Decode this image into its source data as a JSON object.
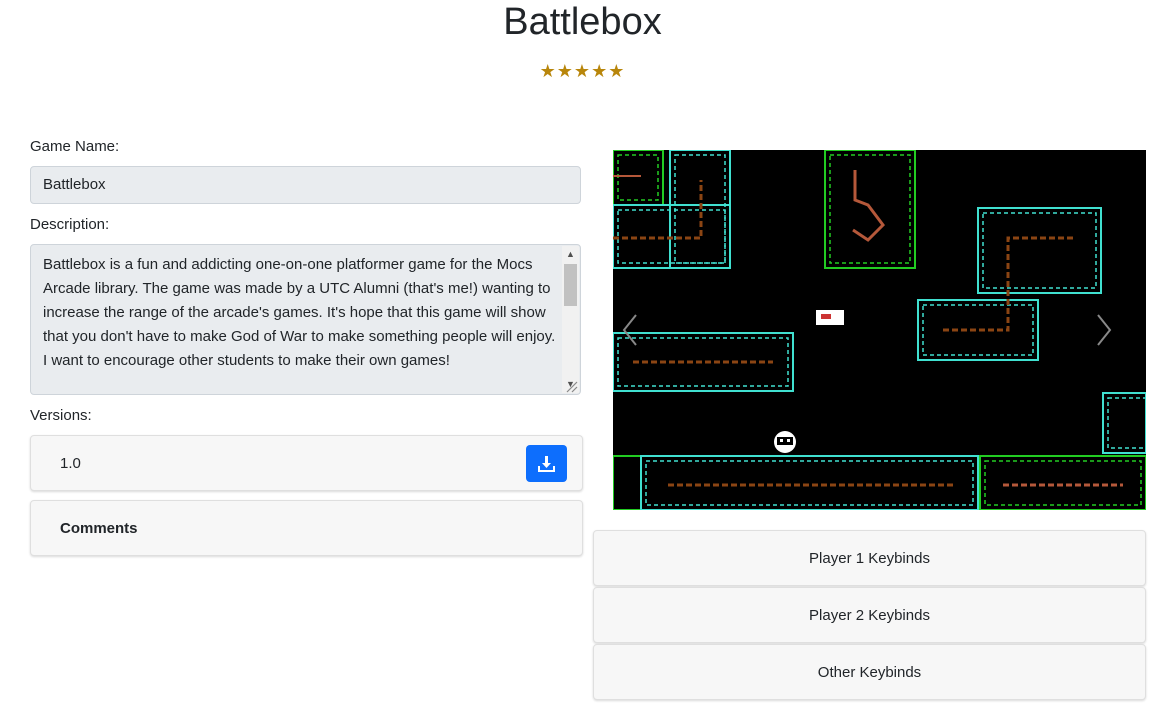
{
  "game": {
    "title": "Battlebox",
    "rating": 5,
    "stars": "★★★★★"
  },
  "form": {
    "name_label": "Game Name:",
    "name_value": "Battlebox",
    "description_label": "Description:",
    "description_value": "Battlebox is a fun and addicting one-on-one platformer game for the Mocs Arcade library. The game was made by a UTC Alumni (that's me!) wanting to increase the range of the arcade's games. It's hope that this game will show that you don't have to make God of War to make something people will enjoy. I want to encourage other students to make their own games!",
    "versions_label": "Versions:",
    "versions": [
      {
        "version": "1.0",
        "download_icon": "download-icon"
      }
    ],
    "comments_label": "Comments"
  },
  "carousel": {
    "prev_icon": "chevron-left-icon",
    "next_icon": "chevron-right-icon",
    "screenshot": "game-screenshot"
  },
  "keybinds": {
    "player1": "Player 1 Keybinds",
    "player2": "Player 2 Keybinds",
    "other": "Other Keybinds"
  },
  "colors": {
    "accent": "#0d6efd",
    "star": "#b8860b",
    "cyan": "#40e0d0",
    "green": "#22cc22",
    "brown": "#8b4513"
  }
}
